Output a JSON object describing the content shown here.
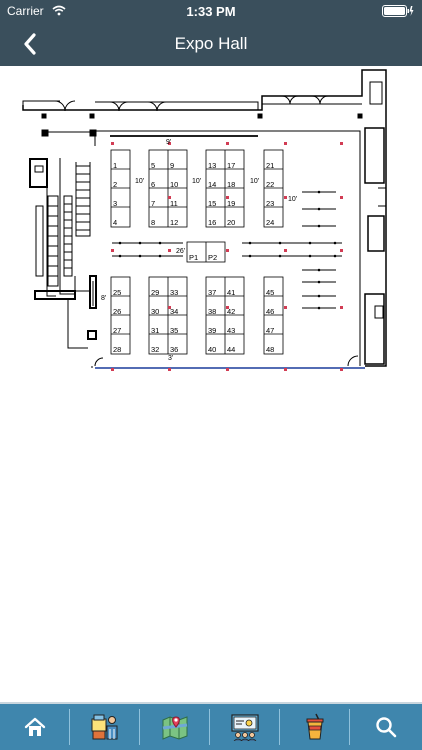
{
  "status_bar": {
    "carrier": "Carrier",
    "time": "1:33 PM"
  },
  "header": {
    "title": "Expo Hall"
  },
  "floorplan": {
    "dimensions": {
      "d1": "9'",
      "d2": "10'",
      "d3": "10'",
      "d4": "10'",
      "d5": "10'",
      "d6": "26'",
      "d7": "8'",
      "d8": "3'"
    },
    "booths": [
      "1",
      "2",
      "3",
      "4",
      "5",
      "6",
      "7",
      "8",
      "9",
      "10",
      "11",
      "12",
      "13",
      "14",
      "15",
      "16",
      "17",
      "18",
      "19",
      "20",
      "21",
      "22",
      "23",
      "24",
      "25",
      "26",
      "27",
      "28",
      "29",
      "30",
      "31",
      "32",
      "33",
      "34",
      "35",
      "36",
      "37",
      "38",
      "39",
      "40",
      "41",
      "42",
      "43",
      "44",
      "45",
      "46",
      "47",
      "48",
      "P1",
      "P2"
    ]
  },
  "tab_bar": {
    "items": [
      "home-icon",
      "exhibitors-icon",
      "map-icon",
      "schedule-icon",
      "drinks-icon",
      "search-icon"
    ]
  },
  "colors": {
    "bar": "#3a4f5c",
    "tab_bar": "#3f86ad"
  }
}
